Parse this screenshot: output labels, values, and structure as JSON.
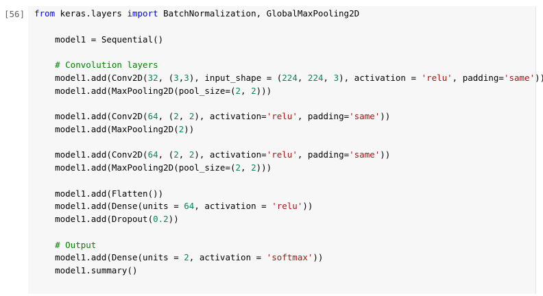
{
  "cell": {
    "execution_count": "[56]",
    "colors": {
      "background": "#f7f7f7",
      "keyword": "#0000ff",
      "number": "#098658",
      "string": "#a31515",
      "comment": "#008000",
      "prompt": "#616161"
    },
    "lines": [
      [
        {
          "t": "kw",
          "v": "from"
        },
        {
          "t": "plain",
          "v": " keras.layers "
        },
        {
          "t": "kw",
          "v": "import"
        },
        {
          "t": "plain",
          "v": " BatchNormalization, GlobalMaxPooling2D"
        }
      ],
      [],
      [
        {
          "t": "plain",
          "v": "    model1 = Sequential()"
        }
      ],
      [],
      [
        {
          "t": "cmt",
          "v": "    # Convolution layers"
        }
      ],
      [
        {
          "t": "plain",
          "v": "    model1.add(Conv2D("
        },
        {
          "t": "num",
          "v": "32"
        },
        {
          "t": "plain",
          "v": ", ("
        },
        {
          "t": "num",
          "v": "3"
        },
        {
          "t": "plain",
          "v": ","
        },
        {
          "t": "num",
          "v": "3"
        },
        {
          "t": "plain",
          "v": "), input_shape = ("
        },
        {
          "t": "num",
          "v": "224"
        },
        {
          "t": "plain",
          "v": ", "
        },
        {
          "t": "num",
          "v": "224"
        },
        {
          "t": "plain",
          "v": ", "
        },
        {
          "t": "num",
          "v": "3"
        },
        {
          "t": "plain",
          "v": "), activation = "
        },
        {
          "t": "str",
          "v": "'relu'"
        },
        {
          "t": "plain",
          "v": ", padding="
        },
        {
          "t": "str",
          "v": "'same'"
        },
        {
          "t": "plain",
          "v": "))"
        }
      ],
      [
        {
          "t": "plain",
          "v": "    model1.add(MaxPooling2D(pool_size=("
        },
        {
          "t": "num",
          "v": "2"
        },
        {
          "t": "plain",
          "v": ", "
        },
        {
          "t": "num",
          "v": "2"
        },
        {
          "t": "plain",
          "v": ")))"
        }
      ],
      [],
      [
        {
          "t": "plain",
          "v": "    model1.add(Conv2D("
        },
        {
          "t": "num",
          "v": "64"
        },
        {
          "t": "plain",
          "v": ", ("
        },
        {
          "t": "num",
          "v": "2"
        },
        {
          "t": "plain",
          "v": ", "
        },
        {
          "t": "num",
          "v": "2"
        },
        {
          "t": "plain",
          "v": "), activation="
        },
        {
          "t": "str",
          "v": "'relu'"
        },
        {
          "t": "plain",
          "v": ", padding="
        },
        {
          "t": "str",
          "v": "'same'"
        },
        {
          "t": "plain",
          "v": "))"
        }
      ],
      [
        {
          "t": "plain",
          "v": "    model1.add(MaxPooling2D("
        },
        {
          "t": "num",
          "v": "2"
        },
        {
          "t": "plain",
          "v": "))"
        }
      ],
      [],
      [
        {
          "t": "plain",
          "v": "    model1.add(Conv2D("
        },
        {
          "t": "num",
          "v": "64"
        },
        {
          "t": "plain",
          "v": ", ("
        },
        {
          "t": "num",
          "v": "2"
        },
        {
          "t": "plain",
          "v": ", "
        },
        {
          "t": "num",
          "v": "2"
        },
        {
          "t": "plain",
          "v": "), activation="
        },
        {
          "t": "str",
          "v": "'relu'"
        },
        {
          "t": "plain",
          "v": ", padding="
        },
        {
          "t": "str",
          "v": "'same'"
        },
        {
          "t": "plain",
          "v": "))"
        }
      ],
      [
        {
          "t": "plain",
          "v": "    model1.add(MaxPooling2D(pool_size=("
        },
        {
          "t": "num",
          "v": "2"
        },
        {
          "t": "plain",
          "v": ", "
        },
        {
          "t": "num",
          "v": "2"
        },
        {
          "t": "plain",
          "v": ")))"
        }
      ],
      [],
      [
        {
          "t": "plain",
          "v": "    model1.add(Flatten())"
        }
      ],
      [
        {
          "t": "plain",
          "v": "    model1.add(Dense(units = "
        },
        {
          "t": "num",
          "v": "64"
        },
        {
          "t": "plain",
          "v": ", activation = "
        },
        {
          "t": "str",
          "v": "'relu'"
        },
        {
          "t": "plain",
          "v": "))"
        }
      ],
      [
        {
          "t": "plain",
          "v": "    model1.add(Dropout("
        },
        {
          "t": "num",
          "v": "0.2"
        },
        {
          "t": "plain",
          "v": "))"
        }
      ],
      [],
      [
        {
          "t": "cmt",
          "v": "    # Output"
        }
      ],
      [
        {
          "t": "plain",
          "v": "    model1.add(Dense(units = "
        },
        {
          "t": "num",
          "v": "2"
        },
        {
          "t": "plain",
          "v": ", activation = "
        },
        {
          "t": "str",
          "v": "'softmax'"
        },
        {
          "t": "plain",
          "v": "))"
        }
      ],
      [
        {
          "t": "plain",
          "v": "    model1.summary()"
        }
      ]
    ]
  }
}
